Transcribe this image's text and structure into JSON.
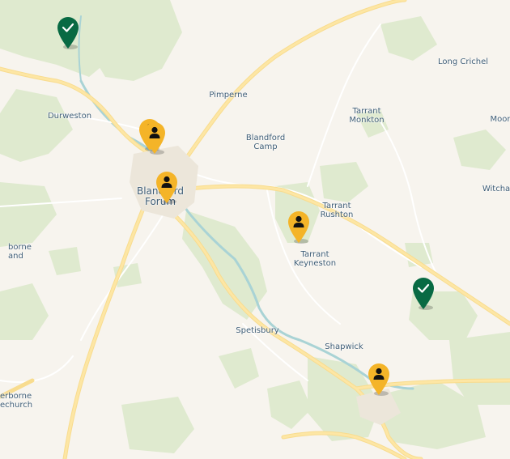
{
  "map": {
    "colors": {
      "land": "#f7f4ee",
      "green": "#dfeacf",
      "water": "#a9d3d5",
      "road_major": "#fde6a4",
      "road_minor": "#ffffff",
      "marker_person": "#f4b428",
      "marker_check": "#086a43",
      "label": "#3f5e77"
    },
    "places": [
      {
        "id": "durweston",
        "name": "Durweston"
      },
      {
        "id": "pimperne",
        "name": "Pimperne"
      },
      {
        "id": "long-crichel",
        "name": "Long Crichel"
      },
      {
        "id": "tarrant-monkton",
        "name": "Tarrant\nMonkton"
      },
      {
        "id": "moor",
        "name": "Moor"
      },
      {
        "id": "blandford-camp",
        "name": "Blandford\nCamp"
      },
      {
        "id": "blandford-forum",
        "name": "Blandford\nForum"
      },
      {
        "id": "witcha",
        "name": "Witcha"
      },
      {
        "id": "tarrant-rushton",
        "name": "Tarrant\nRushton"
      },
      {
        "id": "tarrant-keyneston",
        "name": "Tarrant\nKeyneston"
      },
      {
        "id": "spetisbury",
        "name": "Spetisbury"
      },
      {
        "id": "shapwick",
        "name": "Shapwick"
      },
      {
        "id": "left-1",
        "name": "borne\nand"
      },
      {
        "id": "left-2",
        "name": "erborne\nechurch"
      }
    ],
    "markers": [
      {
        "id": "m1",
        "kind": "check",
        "icon": "check-icon"
      },
      {
        "id": "m2",
        "kind": "person",
        "icon": "person-icon"
      },
      {
        "id": "m3",
        "kind": "person",
        "icon": "person-icon"
      },
      {
        "id": "m4",
        "kind": "person",
        "icon": "person-icon"
      },
      {
        "id": "m5",
        "kind": "person",
        "icon": "person-icon"
      },
      {
        "id": "m6",
        "kind": "check",
        "icon": "check-icon"
      },
      {
        "id": "m7",
        "kind": "person",
        "icon": "person-icon"
      }
    ]
  }
}
